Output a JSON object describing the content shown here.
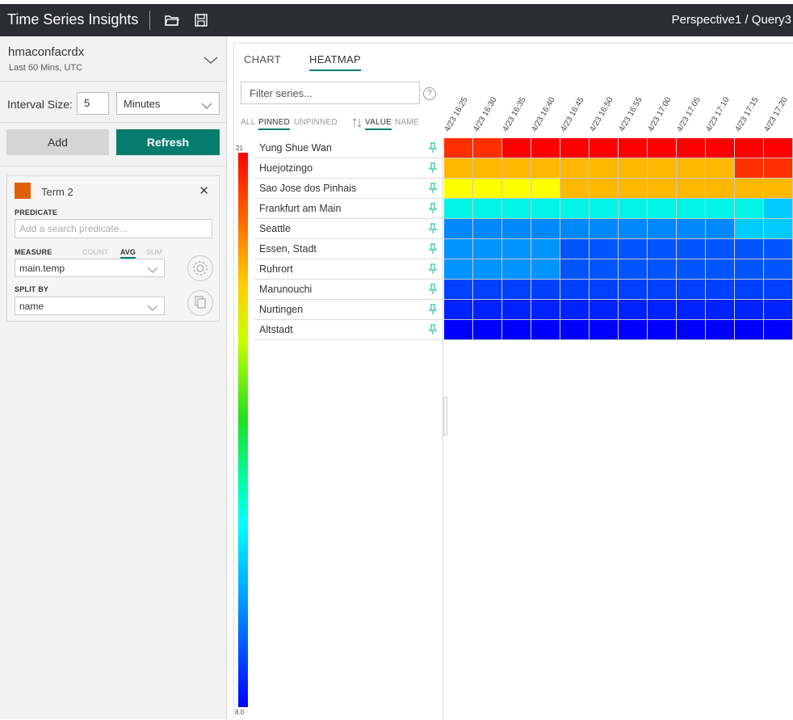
{
  "app": {
    "title": "Time Series Insights",
    "breadcrumb": "Perspective1 / Query3"
  },
  "environment": {
    "name": "hmaconfacrdx",
    "range": "Last 60 Mins, UTC"
  },
  "interval": {
    "label": "Interval Size:",
    "value": "5",
    "unit": "Minutes"
  },
  "actions": {
    "add": "Add",
    "refresh": "Refresh"
  },
  "term": {
    "name": "Term 2",
    "color": "#e25f0a",
    "predicate_label": "PREDICATE",
    "predicate_placeholder": "Add a search predicate...",
    "measure_label": "MEASURE",
    "measure_options": [
      "COUNT",
      "AVG",
      "SUM"
    ],
    "measure_selected": "AVG",
    "measure_value": "main.temp",
    "split_label": "SPLIT BY",
    "split_value": "name"
  },
  "tabs": [
    "CHART",
    "HEATMAP"
  ],
  "active_tab": "HEATMAP",
  "filter": {
    "placeholder": "Filter series..."
  },
  "view_options": {
    "all": "ALL",
    "pinned": "PINNED",
    "unpinned": "UNPINNED",
    "value": "VALUE",
    "name": "NAME"
  },
  "legend": {
    "max": "21",
    "min": "8.0"
  },
  "columns": [
    "4/23 16:25",
    "4/23 16:30",
    "4/23 16:35",
    "4/23 16:40",
    "4/23 16:45",
    "4/23 16:50",
    "4/23 16:55",
    "4/23 17:00",
    "4/23 17:05",
    "4/23 17:10",
    "4/23 17:15",
    "4/23 17:20"
  ],
  "series": [
    {
      "name": "Yung Shue Wan",
      "colors": [
        "#ff3000",
        "#ff3000",
        "#ff0000",
        "#ff0000",
        "#ff0000",
        "#ff0000",
        "#ff0000",
        "#ff0000",
        "#ff0000",
        "#ff0000",
        "#ff0000",
        "#ff0000"
      ]
    },
    {
      "name": "Huejotzingo",
      "colors": [
        "#ffb800",
        "#ffb800",
        "#ffb800",
        "#ffb800",
        "#ffb800",
        "#ffb800",
        "#ffb800",
        "#ffb800",
        "#ffb800",
        "#ffb800",
        "#ff3000",
        "#ff3000"
      ]
    },
    {
      "name": "Sao Jose dos Pinhais",
      "colors": [
        "#ffff00",
        "#ffff00",
        "#ffff00",
        "#ffff00",
        "#ffb800",
        "#ffb800",
        "#ffb800",
        "#ffb800",
        "#ffb800",
        "#ffb800",
        "#ffb800",
        "#ffb800"
      ]
    },
    {
      "name": "Frankfurt am Main",
      "colors": [
        "#00f5e6",
        "#00f5e6",
        "#00f5e6",
        "#00f5e6",
        "#00f5e6",
        "#00f5e6",
        "#00f5e6",
        "#00f5e6",
        "#00f5e6",
        "#00f5e6",
        "#00f5e6",
        "#00ccff"
      ]
    },
    {
      "name": "Seattle",
      "colors": [
        "#0088ff",
        "#0088ff",
        "#0088ff",
        "#0088ff",
        "#0088ff",
        "#0088ff",
        "#0088ff",
        "#0088ff",
        "#0088ff",
        "#0088ff",
        "#00ccff",
        "#00ccff"
      ]
    },
    {
      "name": "Essen, Stadt",
      "colors": [
        "#0094ff",
        "#0094ff",
        "#0094ff",
        "#0094ff",
        "#0055ff",
        "#0055ff",
        "#0055ff",
        "#0055ff",
        "#0055ff",
        "#0055ff",
        "#0055ff",
        "#0055ff"
      ]
    },
    {
      "name": "Ruhrort",
      "colors": [
        "#0094ff",
        "#0094ff",
        "#0094ff",
        "#0094ff",
        "#0055ff",
        "#0055ff",
        "#0055ff",
        "#0055ff",
        "#0055ff",
        "#0055ff",
        "#0055ff",
        "#0055ff"
      ]
    },
    {
      "name": "Marunouchi",
      "colors": [
        "#0040ff",
        "#0040ff",
        "#0040ff",
        "#0040ff",
        "#0040ff",
        "#0040ff",
        "#0040ff",
        "#0040ff",
        "#0040ff",
        "#0040ff",
        "#0040ff",
        "#0040ff"
      ]
    },
    {
      "name": "Nurtingen",
      "colors": [
        "#0022ff",
        "#0022ff",
        "#0022ff",
        "#0022ff",
        "#0022ff",
        "#0022ff",
        "#0022ff",
        "#0022ff",
        "#0022ff",
        "#0022ff",
        "#0022ff",
        "#0022ff"
      ]
    },
    {
      "name": "Altstadt",
      "colors": [
        "#0000ff",
        "#0000ff",
        "#0000ff",
        "#0000ff",
        "#0000ff",
        "#0000ff",
        "#0000ff",
        "#0000ff",
        "#0000ff",
        "#0000ff",
        "#0000ff",
        "#0000ff"
      ]
    }
  ]
}
